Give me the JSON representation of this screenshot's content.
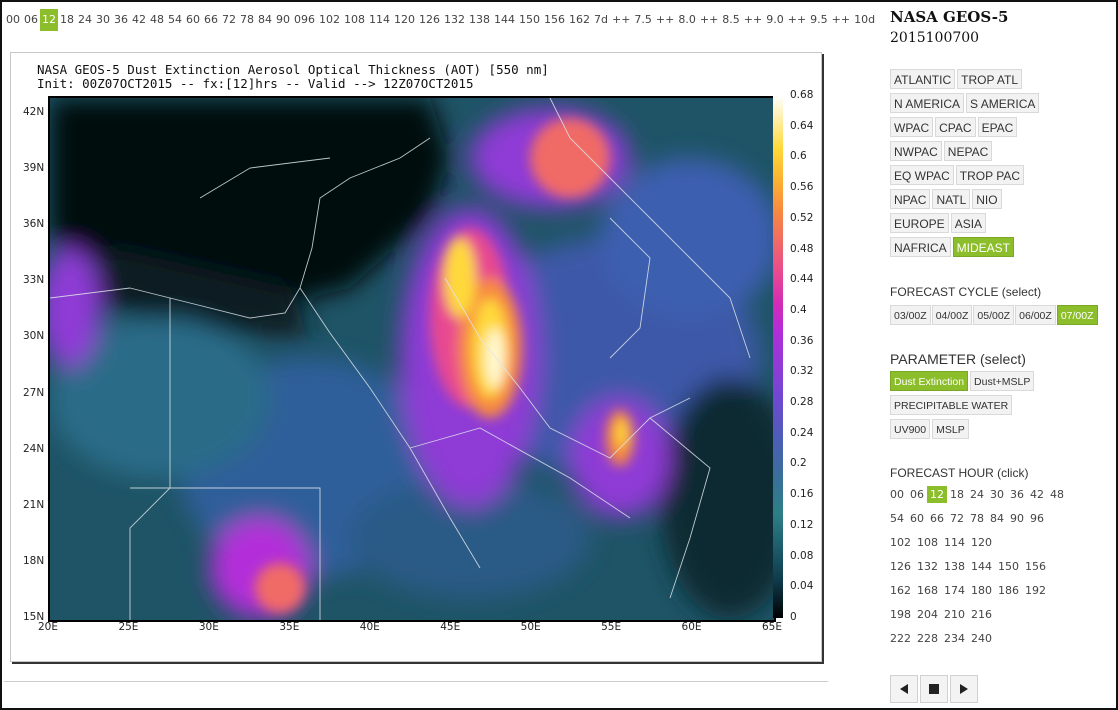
{
  "hour_strip": [
    "00",
    "06",
    "12",
    "18",
    "24",
    "30",
    "36",
    "42",
    "48",
    "54",
    "60",
    "66",
    "72",
    "78",
    "84",
    "90",
    "096",
    "102",
    "108",
    "114",
    "120",
    "126",
    "132",
    "138",
    "144",
    "150",
    "156",
    "162",
    "7d",
    "++",
    "7.5",
    "++",
    "8.0",
    "++",
    "8.5",
    "++",
    "9.0",
    "++",
    "9.5",
    "++",
    "10d"
  ],
  "hour_strip_selected_index": 2,
  "map": {
    "title_line1": "NASA GEOS-5 Dust Extinction Aerosol Optical Thickness (AOT) [550 nm]",
    "title_line2": "Init: 00Z07OCT2015 -- fx:[12]hrs -- Valid --> 12Z07OCT2015",
    "lat_labels": [
      "42N",
      "39N",
      "36N",
      "33N",
      "30N",
      "27N",
      "24N",
      "21N",
      "18N",
      "15N"
    ],
    "lon_labels": [
      "20E",
      "25E",
      "30E",
      "35E",
      "40E",
      "45E",
      "50E",
      "55E",
      "60E",
      "65E"
    ],
    "colorbar_labels": [
      "0.68",
      "0.64",
      "0.6",
      "0.56",
      "0.52",
      "0.48",
      "0.44",
      "0.4",
      "0.36",
      "0.32",
      "0.28",
      "0.24",
      "0.2",
      "0.16",
      "0.12",
      "0.08",
      "0.04",
      "0"
    ]
  },
  "sidebar": {
    "title": "NASA GEOS-5",
    "date": "2015100700",
    "regions": [
      "ATLANTIC",
      "TROP ATL",
      "N AMERICA",
      "S AMERICA",
      "WPAC",
      "CPAC",
      "EPAC",
      "NWPAC",
      "NEPAC",
      "EQ WPAC",
      "TROP PAC",
      "NPAC",
      "NATL",
      "NIO",
      "EUROPE",
      "ASIA",
      "NAFRICA",
      "MIDEAST"
    ],
    "selected_region": "MIDEAST",
    "forecast_cycle_heading": "FORECAST CYCLE (select)",
    "cycles": [
      "03/00Z",
      "04/00Z",
      "05/00Z",
      "06/00Z",
      "07/00Z"
    ],
    "selected_cycle": "07/00Z",
    "parameter_heading": "PARAMETER (select)",
    "parameters": [
      "Dust Extinction",
      "Dust+MSLP",
      "PRECIPITABLE WATER",
      "UV900",
      "MSLP"
    ],
    "selected_parameter": "Dust Extinction",
    "forecast_hour_heading": "FORECAST HOUR (click)",
    "forecast_hours": [
      [
        "00",
        "06",
        "12",
        "18",
        "24",
        "30",
        "36",
        "42",
        "48"
      ],
      [
        "54",
        "60",
        "66",
        "72",
        "78",
        "84",
        "90",
        "96"
      ],
      [
        "102",
        "108",
        "114",
        "120"
      ],
      [
        "126",
        "132",
        "138",
        "144",
        "150",
        "156"
      ],
      [
        "162",
        "168",
        "174",
        "180",
        "186",
        "192"
      ],
      [
        "198",
        "204",
        "210",
        "216"
      ],
      [
        "222",
        "228",
        "234",
        "240"
      ]
    ],
    "selected_hour": "12",
    "nav": [
      "prev-icon",
      "stop-icon",
      "next-icon"
    ]
  },
  "colors": {
    "accent": "#8cbd2b"
  }
}
